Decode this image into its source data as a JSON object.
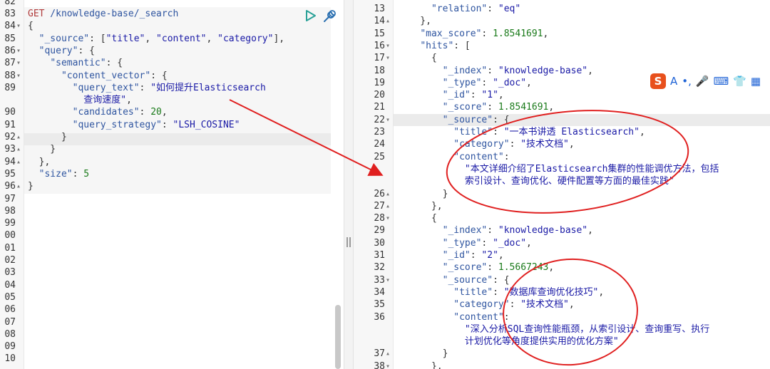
{
  "left_pane": {
    "request": {
      "method": "GET",
      "path": " /knowledge-base/_search"
    },
    "line_numbers": [
      "82",
      "83",
      "84",
      "85",
      "86",
      "87",
      "88",
      "89",
      "",
      "90",
      "91",
      "92",
      "93",
      "94",
      "95",
      "96",
      "97",
      "98",
      "99",
      "00",
      "01",
      "02",
      "03",
      "04",
      "05",
      "06",
      "07",
      "08",
      "09",
      "10"
    ],
    "code_lines": [
      {
        "ln": "83",
        "fold": "",
        "parts": [
          [
            "m",
            "GET"
          ],
          [
            "u",
            " /knowledge-base/_search"
          ]
        ]
      },
      {
        "ln": "84",
        "fold": "▾",
        "parts": [
          [
            "p",
            "{"
          ]
        ]
      },
      {
        "ln": "85",
        "fold": "",
        "parts": [
          [
            "p",
            "  "
          ],
          [
            "k",
            "\"_source\""
          ],
          [
            "p",
            ": ["
          ],
          [
            "s",
            "\"title\""
          ],
          [
            "p",
            ", "
          ],
          [
            "s",
            "\"content\""
          ],
          [
            "p",
            ", "
          ],
          [
            "s",
            "\"category\""
          ],
          [
            "p",
            "],"
          ]
        ]
      },
      {
        "ln": "86",
        "fold": "▾",
        "parts": [
          [
            "p",
            "  "
          ],
          [
            "k",
            "\"query\""
          ],
          [
            "p",
            ": {"
          ]
        ]
      },
      {
        "ln": "87",
        "fold": "▾",
        "parts": [
          [
            "p",
            "    "
          ],
          [
            "k",
            "\"semantic\""
          ],
          [
            "p",
            ": {"
          ]
        ]
      },
      {
        "ln": "88",
        "fold": "▾",
        "parts": [
          [
            "p",
            "      "
          ],
          [
            "k",
            "\"content_vector\""
          ],
          [
            "p",
            ": {"
          ]
        ]
      },
      {
        "ln": "89",
        "fold": "",
        "parts": [
          [
            "p",
            "        "
          ],
          [
            "k",
            "\"query_text\""
          ],
          [
            "p",
            ": "
          ],
          [
            "s",
            "\"如何提升Elasticsearch"
          ]
        ]
      },
      {
        "ln": "",
        "fold": "",
        "parts": [
          [
            "s",
            "          查询速度\""
          ],
          [
            "p",
            ","
          ]
        ]
      },
      {
        "ln": "90",
        "fold": "",
        "parts": [
          [
            "p",
            "        "
          ],
          [
            "k",
            "\"candidates\""
          ],
          [
            "p",
            ": "
          ],
          [
            "n",
            "20"
          ],
          [
            "p",
            ","
          ]
        ]
      },
      {
        "ln": "91",
        "fold": "",
        "parts": [
          [
            "p",
            "        "
          ],
          [
            "k",
            "\"query_strategy\""
          ],
          [
            "p",
            ": "
          ],
          [
            "s",
            "\"LSH_COSINE\""
          ]
        ]
      },
      {
        "ln": "92",
        "fold": "▴",
        "parts": [
          [
            "p",
            "      }"
          ]
        ]
      },
      {
        "ln": "93",
        "fold": "▴",
        "parts": [
          [
            "p",
            "    }"
          ]
        ]
      },
      {
        "ln": "94",
        "fold": "▴",
        "parts": [
          [
            "p",
            "  },"
          ]
        ]
      },
      {
        "ln": "95",
        "fold": "",
        "parts": [
          [
            "p",
            "  "
          ],
          [
            "k",
            "\"size\""
          ],
          [
            "p",
            ": "
          ],
          [
            "n",
            "5"
          ]
        ]
      },
      {
        "ln": "96",
        "fold": "▴",
        "parts": [
          [
            "p",
            "}"
          ]
        ]
      },
      {
        "ln": "97",
        "fold": "",
        "parts": []
      },
      {
        "ln": "98",
        "fold": "",
        "parts": []
      },
      {
        "ln": "99",
        "fold": "",
        "parts": []
      },
      {
        "ln": "00",
        "fold": "",
        "parts": []
      },
      {
        "ln": "01",
        "fold": "",
        "parts": []
      },
      {
        "ln": "02",
        "fold": "",
        "parts": []
      },
      {
        "ln": "03",
        "fold": "",
        "parts": []
      },
      {
        "ln": "04",
        "fold": "",
        "parts": []
      },
      {
        "ln": "05",
        "fold": "",
        "parts": []
      },
      {
        "ln": "06",
        "fold": "",
        "parts": []
      },
      {
        "ln": "07",
        "fold": "",
        "parts": []
      },
      {
        "ln": "08",
        "fold": "",
        "parts": []
      },
      {
        "ln": "09",
        "fold": "",
        "parts": []
      },
      {
        "ln": "10",
        "fold": "",
        "parts": []
      }
    ],
    "first_line": "82"
  },
  "right_pane": {
    "code_lines": [
      {
        "ln": "13",
        "fold": "",
        "parts": [
          [
            "p",
            "      "
          ],
          [
            "k",
            "\"relation\""
          ],
          [
            "p",
            ": "
          ],
          [
            "s",
            "\"eq\""
          ]
        ]
      },
      {
        "ln": "14",
        "fold": "▴",
        "parts": [
          [
            "p",
            "    },"
          ]
        ]
      },
      {
        "ln": "15",
        "fold": "",
        "parts": [
          [
            "p",
            "    "
          ],
          [
            "k",
            "\"max_score\""
          ],
          [
            "p",
            ": "
          ],
          [
            "n",
            "1.8541691"
          ],
          [
            "p",
            ","
          ]
        ]
      },
      {
        "ln": "16",
        "fold": "▾",
        "parts": [
          [
            "p",
            "    "
          ],
          [
            "k",
            "\"hits\""
          ],
          [
            "p",
            ": ["
          ]
        ]
      },
      {
        "ln": "17",
        "fold": "▾",
        "parts": [
          [
            "p",
            "      {"
          ]
        ]
      },
      {
        "ln": "18",
        "fold": "",
        "parts": [
          [
            "p",
            "        "
          ],
          [
            "k",
            "\"_index\""
          ],
          [
            "p",
            ": "
          ],
          [
            "s",
            "\"knowledge-base\""
          ],
          [
            "p",
            ","
          ]
        ]
      },
      {
        "ln": "19",
        "fold": "",
        "parts": [
          [
            "p",
            "        "
          ],
          [
            "k",
            "\"_type\""
          ],
          [
            "p",
            ": "
          ],
          [
            "s",
            "\"_doc\""
          ],
          [
            "p",
            ","
          ]
        ]
      },
      {
        "ln": "20",
        "fold": "",
        "parts": [
          [
            "p",
            "        "
          ],
          [
            "k",
            "\"_id\""
          ],
          [
            "p",
            ": "
          ],
          [
            "s",
            "\"1\""
          ],
          [
            "p",
            ","
          ]
        ]
      },
      {
        "ln": "21",
        "fold": "",
        "parts": [
          [
            "p",
            "        "
          ],
          [
            "k",
            "\"_score\""
          ],
          [
            "p",
            ": "
          ],
          [
            "n",
            "1.8541691"
          ],
          [
            "p",
            ","
          ]
        ]
      },
      {
        "ln": "22",
        "fold": "▾",
        "parts": [
          [
            "p",
            "        "
          ],
          [
            "k",
            "\"_source\""
          ],
          [
            "p",
            ": {"
          ]
        ]
      },
      {
        "ln": "23",
        "fold": "",
        "parts": [
          [
            "p",
            "          "
          ],
          [
            "k",
            "\"title\""
          ],
          [
            "p",
            ": "
          ],
          [
            "s",
            "\"一本书讲透 Elasticsearch\""
          ],
          [
            "p",
            ","
          ]
        ]
      },
      {
        "ln": "24",
        "fold": "",
        "parts": [
          [
            "p",
            "          "
          ],
          [
            "k",
            "\"category\""
          ],
          [
            "p",
            ": "
          ],
          [
            "s",
            "\"技术文档\""
          ],
          [
            "p",
            ","
          ]
        ]
      },
      {
        "ln": "25",
        "fold": "",
        "parts": [
          [
            "p",
            "          "
          ],
          [
            "k",
            "\"content\""
          ],
          [
            "p",
            ":"
          ]
        ]
      },
      {
        "ln": "",
        "fold": "",
        "parts": [
          [
            "s",
            "            \"本文详细介绍了Elasticsearch集群的性能调优方法，包括"
          ]
        ]
      },
      {
        "ln": "",
        "fold": "",
        "parts": [
          [
            "s",
            "            索引设计、查询优化、硬件配置等方面的最佳实践\""
          ]
        ]
      },
      {
        "ln": "26",
        "fold": "▴",
        "parts": [
          [
            "p",
            "        }"
          ]
        ]
      },
      {
        "ln": "27",
        "fold": "▴",
        "parts": [
          [
            "p",
            "      },"
          ]
        ]
      },
      {
        "ln": "28",
        "fold": "▾",
        "parts": [
          [
            "p",
            "      {"
          ]
        ]
      },
      {
        "ln": "29",
        "fold": "",
        "parts": [
          [
            "p",
            "        "
          ],
          [
            "k",
            "\"_index\""
          ],
          [
            "p",
            ": "
          ],
          [
            "s",
            "\"knowledge-base\""
          ],
          [
            "p",
            ","
          ]
        ]
      },
      {
        "ln": "30",
        "fold": "",
        "parts": [
          [
            "p",
            "        "
          ],
          [
            "k",
            "\"_type\""
          ],
          [
            "p",
            ": "
          ],
          [
            "s",
            "\"_doc\""
          ],
          [
            "p",
            ","
          ]
        ]
      },
      {
        "ln": "31",
        "fold": "",
        "parts": [
          [
            "p",
            "        "
          ],
          [
            "k",
            "\"_id\""
          ],
          [
            "p",
            ": "
          ],
          [
            "s",
            "\"2\""
          ],
          [
            "p",
            ","
          ]
        ]
      },
      {
        "ln": "32",
        "fold": "",
        "parts": [
          [
            "p",
            "        "
          ],
          [
            "k",
            "\"_score\""
          ],
          [
            "p",
            ": "
          ],
          [
            "n",
            "1.5667243"
          ],
          [
            "p",
            ","
          ]
        ]
      },
      {
        "ln": "33",
        "fold": "▾",
        "parts": [
          [
            "p",
            "        "
          ],
          [
            "k",
            "\"_source\""
          ],
          [
            "p",
            ": {"
          ]
        ]
      },
      {
        "ln": "34",
        "fold": "",
        "parts": [
          [
            "p",
            "          "
          ],
          [
            "k",
            "\"title\""
          ],
          [
            "p",
            ": "
          ],
          [
            "s",
            "\"数据库查询优化技巧\""
          ],
          [
            "p",
            ","
          ]
        ]
      },
      {
        "ln": "35",
        "fold": "",
        "parts": [
          [
            "p",
            "          "
          ],
          [
            "k",
            "\"category\""
          ],
          [
            "p",
            ": "
          ],
          [
            "s",
            "\"技术文档\""
          ],
          [
            "p",
            ","
          ]
        ]
      },
      {
        "ln": "36",
        "fold": "",
        "parts": [
          [
            "p",
            "          "
          ],
          [
            "k",
            "\"content\""
          ],
          [
            "p",
            ":"
          ]
        ]
      },
      {
        "ln": "",
        "fold": "",
        "parts": [
          [
            "s",
            "            \"深入分析SQL查询性能瓶颈，从索引设计、查询重写、执行"
          ]
        ]
      },
      {
        "ln": "",
        "fold": "",
        "parts": [
          [
            "s",
            "            计划优化等角度提供实用的优化方案\""
          ]
        ]
      },
      {
        "ln": "37",
        "fold": "▴",
        "parts": [
          [
            "p",
            "        }"
          ]
        ]
      },
      {
        "ln": "38",
        "fold": "▾",
        "parts": [
          [
            "p",
            "      },"
          ]
        ]
      }
    ]
  },
  "ime_toolbar": {
    "logo": "S",
    "items": [
      "A",
      "•,",
      "🎤",
      "⌨",
      "👕",
      "▦"
    ]
  },
  "colors": {
    "annotation": "#e02020",
    "keyword": "#2f55a0",
    "string": "#1a1aa6",
    "number": "#1a7a1a"
  }
}
